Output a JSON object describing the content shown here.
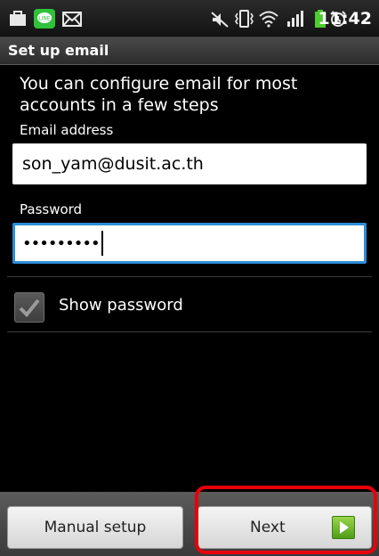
{
  "status_bar": {
    "time": "11:42",
    "icons": [
      "briefcase-icon",
      "line-app-icon",
      "mail-icon",
      "mute-icon",
      "vibrate-icon",
      "wifi-icon",
      "signal-icon",
      "battery-icon",
      "alarm-icon"
    ]
  },
  "title_bar": {
    "title": "Set up email"
  },
  "form": {
    "intro": "You can configure email for most accounts in a few steps",
    "email_label": "Email address",
    "email_value": "son_yam@dusit.ac.th",
    "password_label": "Password",
    "password_value": "•••••••••",
    "show_password_label": "Show password",
    "show_password_checked": true
  },
  "buttons": {
    "manual_label": "Manual setup",
    "next_label": "Next"
  },
  "colors": {
    "focus_border": "#2d8dd6",
    "highlight": "#e8000b",
    "next_icon": "#6cb52a"
  }
}
